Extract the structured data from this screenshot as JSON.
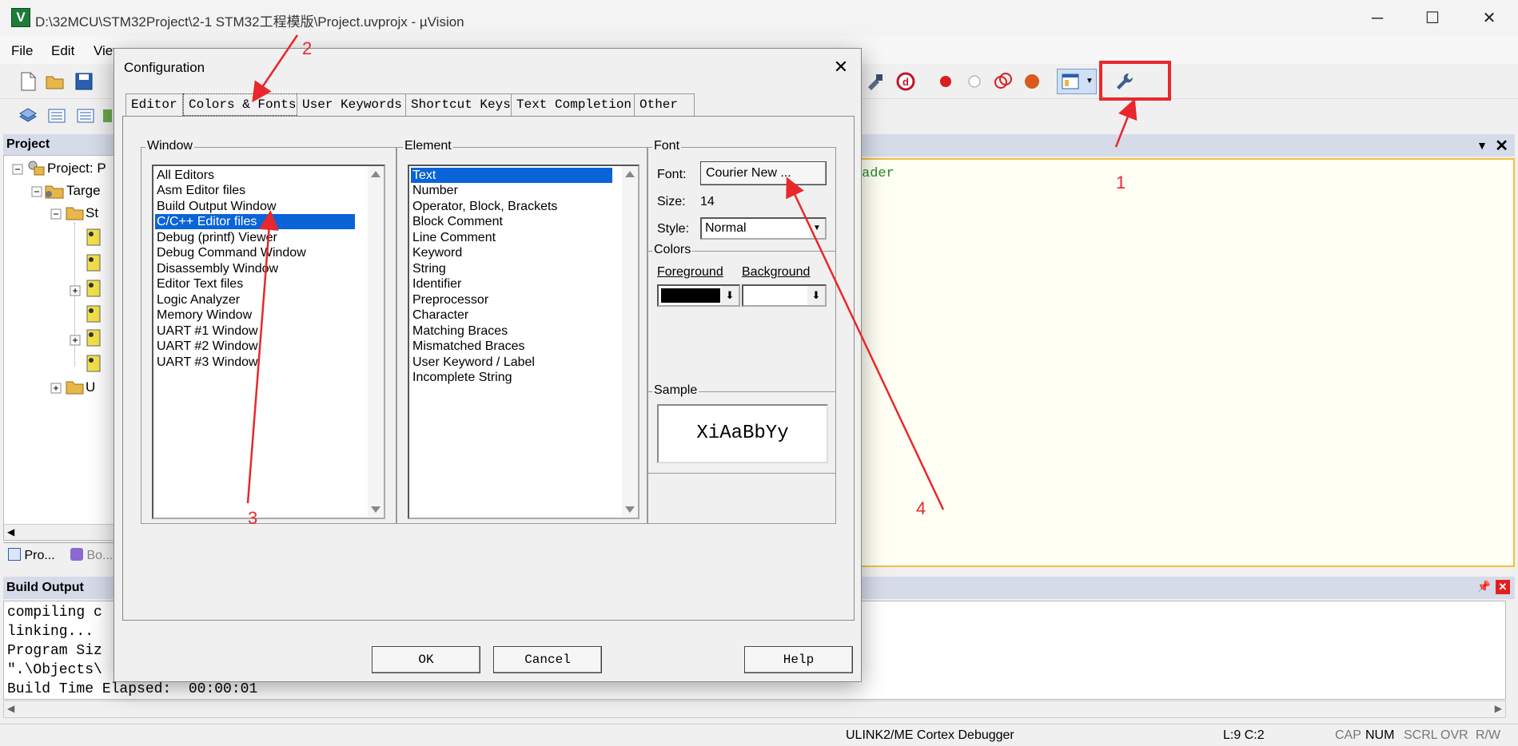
{
  "window": {
    "icon_letter": "V",
    "title": "D:\\32MCU\\STM32Project\\2-1 STM32工程模版\\Project.uvprojx - µVision"
  },
  "menu": [
    "File",
    "Edit",
    "View"
  ],
  "project_pane": {
    "header": "Project",
    "tree": [
      "Project: P",
      "Targe",
      "St",
      "U"
    ],
    "tabs": [
      "Pro...",
      "Bo..."
    ]
  },
  "editor": {
    "code_fragment": "ader"
  },
  "build_output": {
    "header": "Build Output",
    "lines": [
      "compiling c",
      "linking...",
      "Program Siz",
      "\".\\Objects\\",
      "Build Time Elapsed:  00:00:01"
    ]
  },
  "status_bar": {
    "debugger": "ULINK2/ME Cortex Debugger",
    "position": "L:9 C:2",
    "indicators": [
      "CAP",
      "NUM",
      "SCRL",
      "OVR",
      "R/W"
    ]
  },
  "dialog": {
    "title": "Configuration",
    "close_glyph": "✕",
    "tabs": [
      "Editor",
      "Colors & Fonts",
      "User Keywords",
      "Shortcut Keys",
      "Text Completion",
      "Other"
    ],
    "active_tab": "Colors & Fonts",
    "window_group": {
      "label": "Window",
      "items": [
        "All Editors",
        "Asm Editor files",
        "Build Output Window",
        "C/C++ Editor files",
        "Debug (printf) Viewer",
        "Debug Command Window",
        "Disassembly Window",
        "Editor Text files",
        "Logic Analyzer",
        "Memory Window",
        "UART #1 Window",
        "UART #2 Window",
        "UART #3 Window"
      ],
      "selected": "C/C++ Editor files"
    },
    "element_group": {
      "label": "Element",
      "items": [
        "Text",
        "Number",
        "Operator, Block, Brackets",
        "Block Comment",
        "Line Comment",
        "Keyword",
        "String",
        "Identifier",
        "Preprocessor",
        "Character",
        "Matching Braces",
        "Mismatched Braces",
        "User Keyword / Label",
        "Incomplete String"
      ],
      "selected": "Text"
    },
    "font_group": {
      "label": "Font",
      "font_label": "Font:",
      "font_button": "Courier New ...",
      "size_label": "Size:",
      "size_value": "14",
      "style_label": "Style:",
      "style_value": "Normal"
    },
    "colors_group": {
      "label": "Colors",
      "foreground": "Foreground",
      "background": "Background",
      "foreground_color": "#000000",
      "background_color": "#ffffff"
    },
    "sample_group": {
      "label": "Sample",
      "text": "XiAaBbYy"
    },
    "buttons": {
      "ok": "OK",
      "cancel": "Cancel",
      "help": "Help"
    }
  },
  "annotations": {
    "labels": [
      "1",
      "2",
      "3",
      "4"
    ],
    "color": "#e8282c"
  }
}
